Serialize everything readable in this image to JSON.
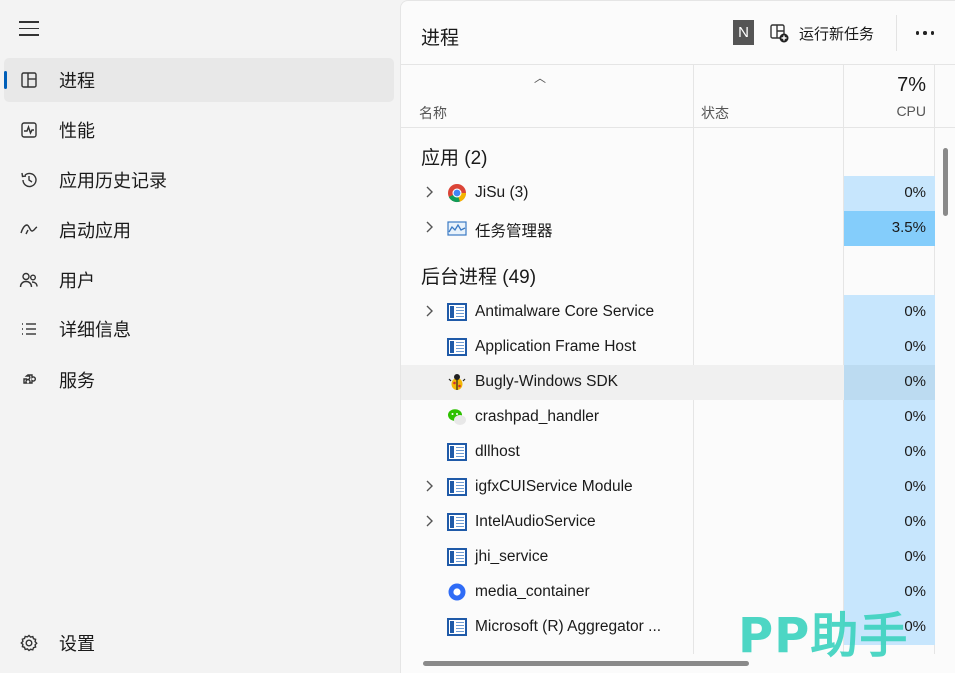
{
  "sidebar": {
    "items": [
      {
        "label": "进程",
        "icon": "processes-icon"
      },
      {
        "label": "性能",
        "icon": "performance-icon"
      },
      {
        "label": "应用历史记录",
        "icon": "app-history-icon"
      },
      {
        "label": "启动应用",
        "icon": "startup-apps-icon"
      },
      {
        "label": "用户",
        "icon": "users-icon"
      },
      {
        "label": "详细信息",
        "icon": "details-icon"
      },
      {
        "label": "服务",
        "icon": "services-icon"
      }
    ],
    "settings_label": "设置"
  },
  "header": {
    "title": "进程",
    "avatar_letter": "N",
    "run_new_task_label": "运行新任务"
  },
  "table": {
    "columns": {
      "name": "名称",
      "status": "状态",
      "cpu_total": "7%",
      "cpu": "CPU"
    },
    "groups": [
      {
        "label": "应用 (2)"
      },
      {
        "label": "后台进程 (49)"
      }
    ],
    "rows": [
      {
        "name": "JiSu (3)",
        "cpu": "0%",
        "icon": "chrome-icon",
        "expandable": true
      },
      {
        "name": "任务管理器",
        "cpu": "3.5%",
        "icon": "task-manager-icon",
        "expandable": true
      },
      {
        "name": "Antimalware Core Service",
        "cpu": "0%",
        "icon": "window-app-icon",
        "expandable": true
      },
      {
        "name": "Application Frame Host",
        "cpu": "0%",
        "icon": "window-app-icon",
        "expandable": false
      },
      {
        "name": "Bugly-Windows SDK",
        "cpu": "0%",
        "icon": "bug-icon",
        "expandable": false
      },
      {
        "name": "crashpad_handler",
        "cpu": "0%",
        "icon": "wechat-icon",
        "expandable": false
      },
      {
        "name": "dllhost",
        "cpu": "0%",
        "icon": "window-app-icon",
        "expandable": false
      },
      {
        "name": "igfxCUIService Module",
        "cpu": "0%",
        "icon": "window-app-icon",
        "expandable": true
      },
      {
        "name": "IntelAudioService",
        "cpu": "0%",
        "icon": "window-app-icon",
        "expandable": true
      },
      {
        "name": "jhi_service",
        "cpu": "0%",
        "icon": "window-app-icon",
        "expandable": false
      },
      {
        "name": "media_container",
        "cpu": "0%",
        "icon": "media-container-icon",
        "expandable": false
      },
      {
        "name": "Microsoft (R) Aggregator ...",
        "cpu": "0%",
        "icon": "window-app-icon",
        "expandable": false
      }
    ]
  },
  "watermark": "PP助手",
  "colors": {
    "accent": "#005fb8",
    "cpu_low": "#c7e6fd",
    "cpu_high": "#84cdfb"
  }
}
